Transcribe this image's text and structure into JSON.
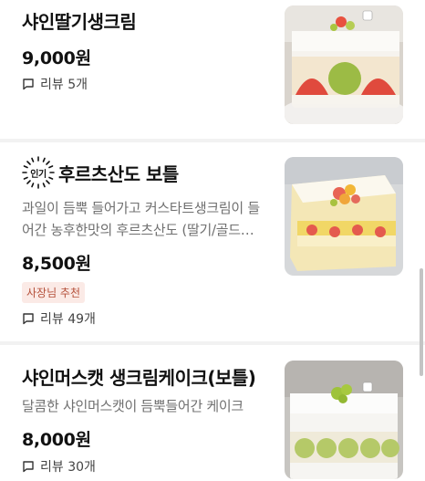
{
  "items": [
    {
      "title": "샤인딸기생크림",
      "price": "9,000원",
      "review": "리뷰 5개"
    },
    {
      "popular_badge": "인기",
      "title": "후르츠산도 보틀",
      "description": "과일이 듬뿍 들어가고 커스타트생크림이 들어간 농후한맛의 후르츠산도 (딸기/골드…",
      "price": "8,500원",
      "owner_badge": "사장님 추천",
      "review": "리뷰 49개"
    },
    {
      "title": "샤인머스캣 생크림케이크(보틀)",
      "description": "달콤한 샤인머스캣이 듬뿍들어간 케이크",
      "price": "8,000원",
      "review": "리뷰 30개"
    }
  ],
  "colors": {
    "badge_bg": "#fbeae6",
    "badge_text": "#b5503a",
    "separator": "#f2f2f2"
  }
}
